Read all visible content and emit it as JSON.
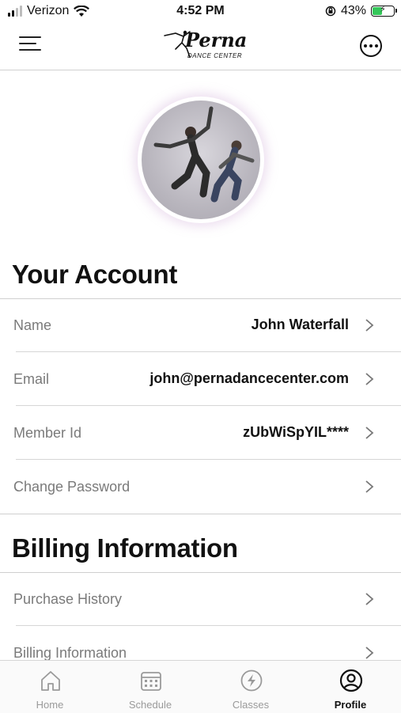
{
  "status": {
    "carrier": "Verizon",
    "time": "4:52 PM",
    "battery": "43%",
    "battery_level": 0.43
  },
  "header": {
    "logo_script": "Perna",
    "logo_sub": "DANCE CENTER"
  },
  "account": {
    "title": "Your Account",
    "rows": [
      {
        "label": "Name",
        "value": "John Waterfall"
      },
      {
        "label": "Email",
        "value": "john@pernadancecenter.com"
      },
      {
        "label": "Member Id",
        "value": "zUbWiSpYIL****"
      },
      {
        "label": "Change Password",
        "value": ""
      }
    ]
  },
  "billing": {
    "title": "Billing Information",
    "rows": [
      {
        "label": "Purchase History"
      },
      {
        "label": "Billing Information"
      }
    ]
  },
  "tabs": [
    {
      "label": "Home",
      "icon": "home-icon"
    },
    {
      "label": "Schedule",
      "icon": "calendar-icon"
    },
    {
      "label": "Classes",
      "icon": "lightning-icon"
    },
    {
      "label": "Profile",
      "icon": "user-circle-icon"
    }
  ],
  "colors": {
    "accent": "#111111",
    "inactive": "#9a9a9a",
    "label": "#7a7a7a",
    "battery": "#34c759"
  }
}
